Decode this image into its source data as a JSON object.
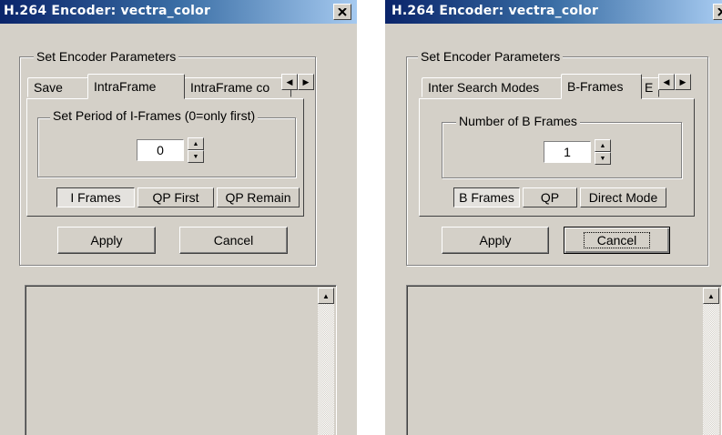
{
  "windows": [
    {
      "title": "H.264 Encoder: vectra_color",
      "group_label": "Set Encoder Parameters",
      "tabs": [
        "Save",
        "IntraFrame",
        "IntraFrame co"
      ],
      "active_tab": "IntraFrame",
      "inner_group_label": "Set Period of I-Frames (0=only first)",
      "spin_value": "0",
      "sub_buttons": [
        "I Frames",
        "QP First",
        "QP Remain"
      ],
      "apply_label": "Apply",
      "cancel_label": "Cancel"
    },
    {
      "title": "H.264 Encoder: vectra_color",
      "group_label": "Set Encoder Parameters",
      "tabs": [
        "Inter Search Modes",
        "B-Frames",
        "E"
      ],
      "active_tab": "B-Frames",
      "inner_group_label": "Number of B Frames",
      "spin_value": "1",
      "sub_buttons": [
        "B Frames",
        "QP",
        "Direct Mode"
      ],
      "apply_label": "Apply",
      "cancel_label": "Cancel"
    }
  ],
  "icons": {
    "close": "close-icon",
    "tab_left": "arrow-left-icon",
    "tab_right": "arrow-right-icon",
    "spin_up": "spin-up-icon",
    "spin_down": "spin-down-icon",
    "scroll_up": "scroll-up-icon"
  },
  "colors": {
    "titlebar_start": "#0a246a",
    "titlebar_end": "#a6caf0",
    "face": "#d4d0c8"
  }
}
